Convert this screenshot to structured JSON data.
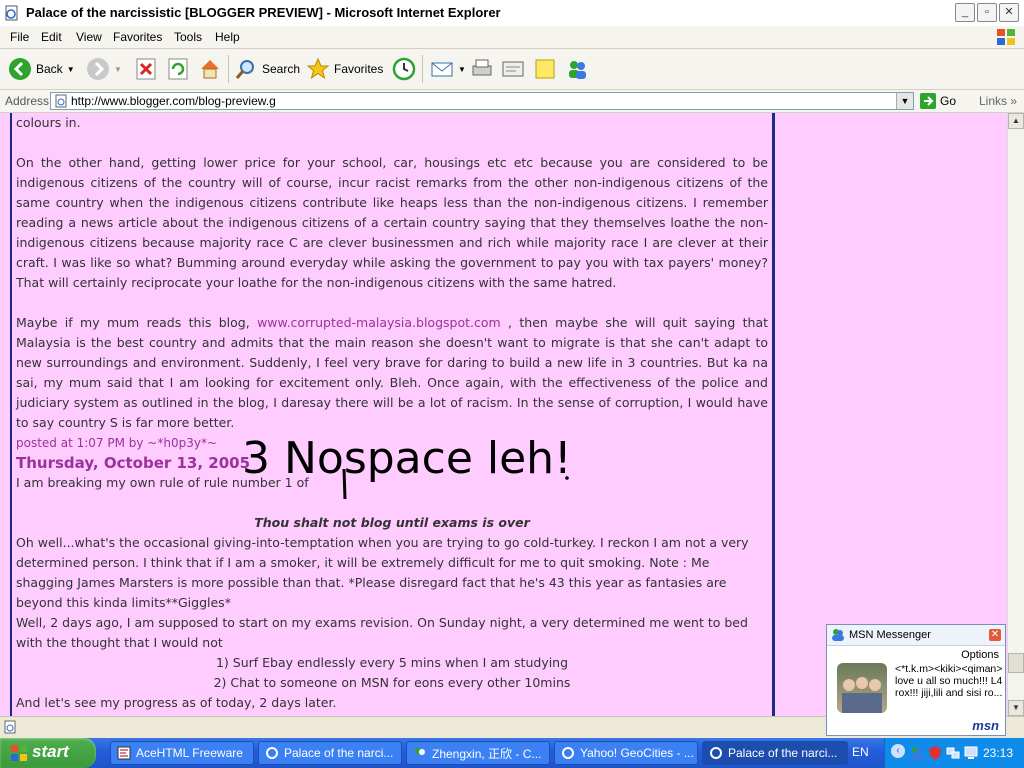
{
  "window": {
    "title": "Palace of the narcissistic [BLOGGER PREVIEW] - Microsoft Internet Explorer",
    "buttons": [
      "_",
      "▫",
      "✕"
    ]
  },
  "menubar": {
    "items": [
      "File",
      "Edit",
      "View",
      "Favorites",
      "Tools",
      "Help"
    ]
  },
  "toolbar": {
    "back": "Back",
    "search": "Search",
    "favorites": "Favorites"
  },
  "addressbar": {
    "label": "Address",
    "url": "http://www.blogger.com/blog-preview.g",
    "go": "Go",
    "links": "Links"
  },
  "post": {
    "line_top": "colours in.",
    "para1": "On the other hand, getting lower price for your school, car, housings etc etc because you are considered to be indigenous citizens of the country will of course, incur racist remarks from the other non-indigenous citizens of the same country when the indigenous citizens contribute like heaps less than the non-indigenous citizens. I remember reading a news article about the indigenous citizens of a certain country saying that they themselves loathe the non-indigenous citizens because majority race C are clever businessmen and rich while majority race I are clever at their craft. I was like so what? Bumming around everyday while asking the government to pay you with tax payers' money? That will certainly reciprocate your loathe for the non-indigenous citizens with the same hatred.",
    "para2_before": "Maybe if my mum reads this blog,",
    "para2_link": "www.corrupted-malaysia.blogspot.com",
    "para2_after": ", then maybe she will quit saying that Malaysia is the best country and admits that the main reason she doesn't want to migrate is that she can't adapt to new surroundings and environment. Suddenly, I feel very brave for daring to build a new life in 3 countries. But ka na sai, my mum said that I am looking for excitement only. Bleh. Once again, with the effectiveness of the police and judiciary system as outlined in the blog, I daresay there will be a lot of racism. In the sense of corruption, I would have to say country S is far more better.",
    "posted": "posted at 1:07 PM by ~*h0p3y*~",
    "date": "Thursday, October 13, 2005",
    "line2": "I am breaking my own rule of rule number 1 of",
    "rule": "Thou shalt not blog until exams is over",
    "para3": "Oh well...what's the occasional giving-into-temptation when you are trying to go cold-turkey. I reckon I am not a very determined person. I think that if I am a smoker, it will be extremely difficult for me to quit smoking. Note : Me shagging James Marsters is more possible than that. *Please disregard fact that he's 43 this year as fantasies are beyond this kinda limits**Giggles*",
    "para4": "Well, 2 days ago, I am supposed to start on my exams revision. On Sunday night, a very determined me went to bed with the thought that I would not",
    "list": [
      "1) Surf Ebay endlessly every 5 mins when I am studying",
      "2) Chat to someone on MSN for eons every other 10mins"
    ],
    "last": "And let's see my progress as of today, 2 days later."
  },
  "scribble": {
    "text": "3 Nospace leh!"
  },
  "msn": {
    "title": "MSN Messenger",
    "options": "Options",
    "message": "<*t.k.m><kiki><qiman> love u all so much!!! L4 rox!!! jiji,lili and sisi ro...",
    "logo": "msn"
  },
  "taskbar": {
    "start": "start",
    "tasks": [
      "AceHTML Freeware",
      "Palace of the narci...",
      "Zhengxin, 正欣 - C...",
      "Yahoo! GeoCities - ...",
      "Palace of the narci..."
    ],
    "lang": "EN",
    "clock": "23:13"
  },
  "colors": {
    "page_bg": "#ffccff",
    "link": "#993399",
    "border": "#1a2a8a",
    "taskbar": "#245edb"
  }
}
